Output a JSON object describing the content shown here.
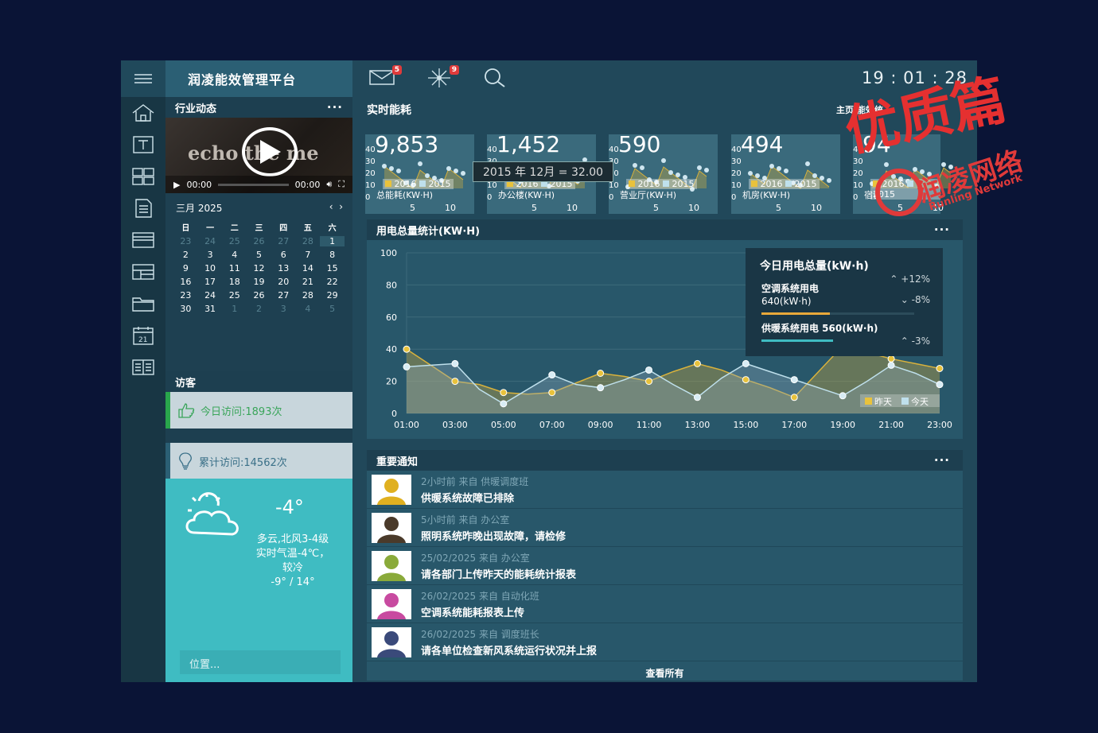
{
  "brand": "润凌能效管理平台",
  "news": {
    "title": "行业动态",
    "more": "···",
    "video_time": "00:00",
    "video_duration": "00:00",
    "video_brand": "echo the me"
  },
  "calendar": {
    "title": "三月 2025",
    "weekdays": [
      "日",
      "一",
      "二",
      "三",
      "四",
      "五",
      "六"
    ],
    "days": [
      [
        "23",
        "24",
        "25",
        "26",
        "27",
        "28",
        "1"
      ],
      [
        "2",
        "3",
        "4",
        "5",
        "6",
        "7",
        "8"
      ],
      [
        "9",
        "10",
        "11",
        "12",
        "13",
        "14",
        "15"
      ],
      [
        "16",
        "17",
        "18",
        "19",
        "20",
        "21",
        "22"
      ],
      [
        "23",
        "24",
        "25",
        "26",
        "27",
        "28",
        "29"
      ],
      [
        "30",
        "31",
        "1",
        "2",
        "3",
        "4",
        "5"
      ]
    ]
  },
  "visitors": {
    "title": "访客",
    "today": "今日访问:1893次",
    "total": "累计访问:14562次"
  },
  "weather": {
    "temp": "-4°",
    "desc": "多云,北风3-4级",
    "desc2": "实时气温-4℃，较冷",
    "range": "-9° / 14°",
    "location": "位置..."
  },
  "topbar": {
    "mail_badge": "5",
    "alert_badge": "9",
    "clock": "19 : 01 : 28"
  },
  "realtime": {
    "title": "实时能耗",
    "tabs": "主页 能效统",
    "cards": [
      {
        "value": "9,853",
        "caption": "总能耗(KW·H)"
      },
      {
        "value": "1,452",
        "caption": "办公楼(KW·H)"
      },
      {
        "value": "590",
        "caption": "营业厅(KW·H)"
      },
      {
        "value": "494",
        "caption": "机房(KW·H)"
      },
      {
        "value": "94",
        "caption": "宿舍"
      }
    ],
    "legend_2016": "2016",
    "legend_2015": "2015",
    "y_ticks": [
      "40",
      "30",
      "20",
      "10",
      "0"
    ],
    "x_ticks": [
      "5",
      "10"
    ],
    "tooltip": "2015 年 12月 = 32.00"
  },
  "usage": {
    "title": "用电总量统计(KW·H)",
    "more": "···",
    "summary_title": "今日用电总量(kW·h)",
    "summary_total_pct": "+12%",
    "ac_label": "空调系统用电",
    "ac_value": "640(kW·h)",
    "ac_pct": "-8%",
    "heat_label": "供暖系统用电 560(kW·h)",
    "heat_pct": "-3%",
    "legend_yesterday": "昨天",
    "legend_today": "今天"
  },
  "chart_data": {
    "type": "area",
    "title": "用电总量统计(KW·H)",
    "x": [
      "01:00",
      "02:00",
      "03:00",
      "04:00",
      "05:00",
      "06:00",
      "07:00",
      "08:00",
      "09:00",
      "10:00",
      "11:00",
      "12:00",
      "13:00",
      "14:00",
      "15:00",
      "16:00",
      "17:00",
      "18:00",
      "19:00",
      "20:00",
      "21:00",
      "22:00",
      "23:00"
    ],
    "x_ticks": [
      "01:00",
      "03:00",
      "05:00",
      "07:00",
      "09:00",
      "11:00",
      "13:00",
      "15:00",
      "17:00",
      "19:00",
      "21:00",
      "23:00"
    ],
    "y_ticks": [
      "0",
      "20",
      "40",
      "60",
      "80",
      "100"
    ],
    "ylim": [
      0,
      100
    ],
    "series": [
      {
        "name": "昨天",
        "color": "#d9b23c",
        "values": [
          40,
          30,
          20,
          18,
          13,
          12,
          13,
          19,
          25,
          23,
          20,
          26,
          31,
          27,
          21,
          16,
          10,
          26,
          42,
          38,
          34,
          31,
          28
        ]
      },
      {
        "name": "今天",
        "color": "#bfe0ec",
        "values": [
          29,
          30,
          31,
          15,
          6,
          15,
          24,
          18,
          16,
          21,
          27,
          18,
          10,
          22,
          31,
          26,
          21,
          16,
          11,
          20,
          30,
          25,
          18
        ]
      }
    ]
  },
  "notices": {
    "title": "重要通知",
    "more": "···",
    "items": [
      {
        "meta": "2小时前 来自 供暖调度班",
        "title": "供暖系统故障已排除",
        "color": "#e0b020"
      },
      {
        "meta": "5小时前 来自 办公室",
        "title": "照明系统昨晚出现故障，请检修",
        "color": "#4a3a2a"
      },
      {
        "meta": "25/02/2025 来自 办公室",
        "title": "请各部门上传昨天的能耗统计报表",
        "color": "#8aaa3a"
      },
      {
        "meta": "26/02/2025 来自 自动化班",
        "title": "空调系统能耗报表上传",
        "color": "#c84aa0"
      },
      {
        "meta": "26/02/2025 来自 调度班长",
        "title": "请各单位检查新风系统运行状况并上报",
        "color": "#3a4a7a"
      }
    ],
    "see_all": "查看所有"
  },
  "watermark": {
    "big": "优质篇",
    "brand": "润凌网络",
    "sub": "Runling Network"
  }
}
